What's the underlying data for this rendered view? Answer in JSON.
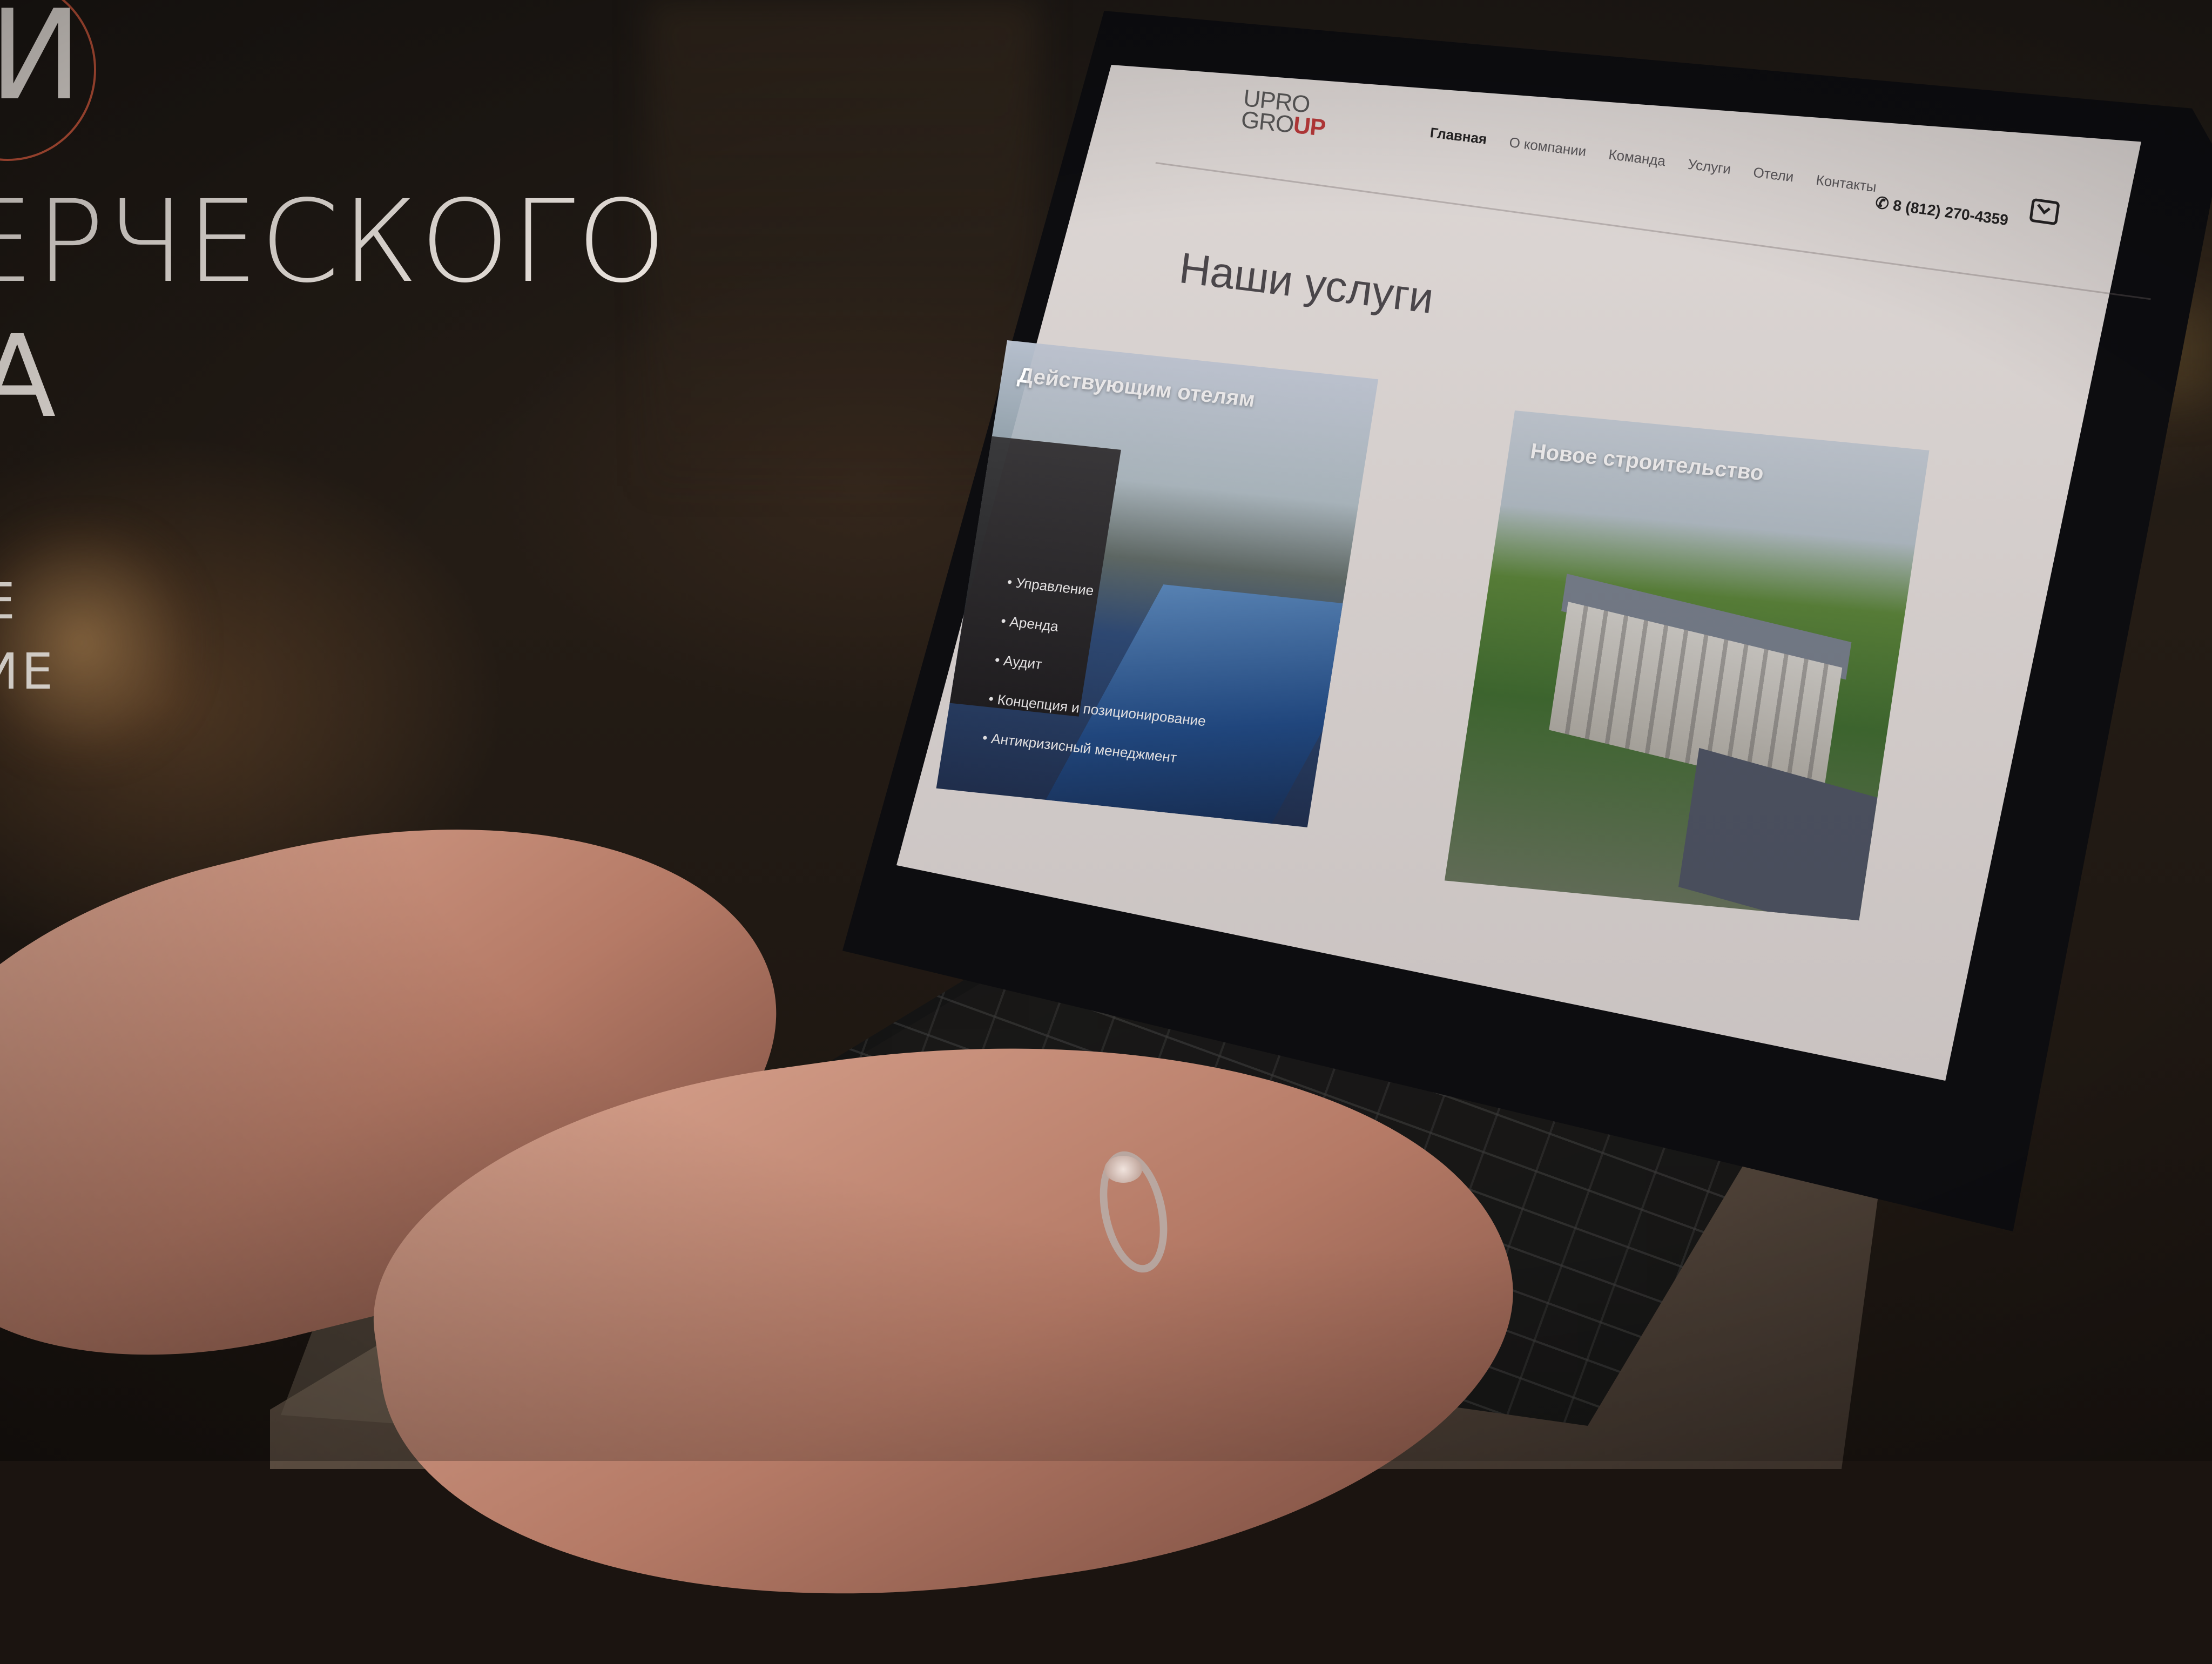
{
  "hero": {
    "line1": "И",
    "line2": "ЕРЧЕСКОГО",
    "line3": "А",
    "sub1": "Е",
    "sub2": "НИЕ"
  },
  "site": {
    "logo": {
      "top": "UPRO",
      "bottom_left": "GRO",
      "bottom_accent": "UP"
    },
    "nav": [
      "Главная",
      "О компании",
      "Команда",
      "Услуги",
      "Отели",
      "Контакты"
    ],
    "active_nav": "Главная",
    "phone": "8 (812) 270-4359",
    "section_title": "Наши услуги",
    "cards": [
      {
        "title": "Действующим отелям",
        "items": [
          "Управление",
          "Аренда",
          "Аудит",
          "Концепция и позиционирование",
          "Антикризисный менеджмент"
        ]
      },
      {
        "title": "Новое строительство",
        "items": []
      }
    ]
  },
  "colors": {
    "accent": "#c9573c",
    "logo_red": "#c23a3a",
    "screen_bg": "#ece7e4"
  },
  "icons": [
    "phone-icon",
    "mail-icon"
  ]
}
